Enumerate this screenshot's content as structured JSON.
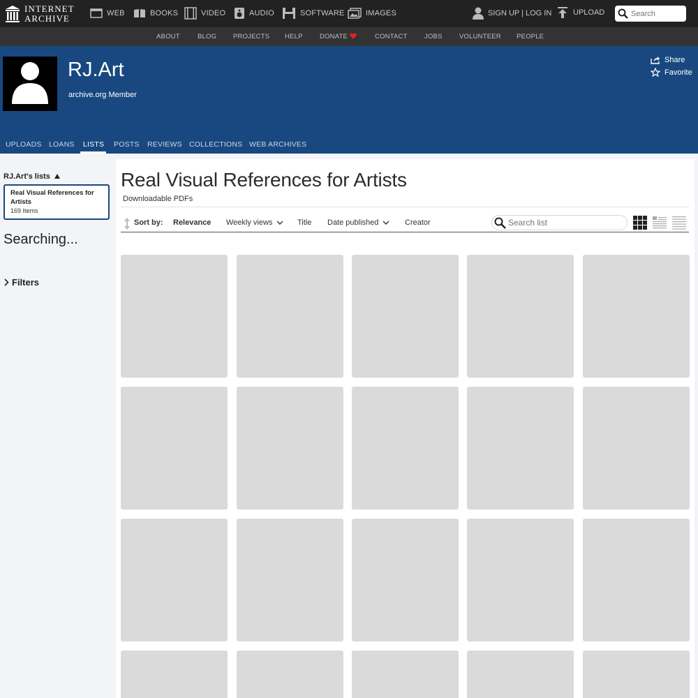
{
  "topbar": {
    "logo_line1": "INTERNET",
    "logo_line2": "ARCHIVE",
    "nav": [
      {
        "label": "WEB",
        "icon": "web-icon"
      },
      {
        "label": "BOOKS",
        "icon": "books-icon"
      },
      {
        "label": "VIDEO",
        "icon": "video-icon"
      },
      {
        "label": "AUDIO",
        "icon": "audio-icon"
      },
      {
        "label": "SOFTWARE",
        "icon": "software-icon"
      },
      {
        "label": "IMAGES",
        "icon": "images-icon"
      }
    ],
    "account_label": "SIGN UP | LOG IN",
    "upload_label": "UPLOAD",
    "search_placeholder": "Search"
  },
  "subnav": [
    "ABOUT",
    "BLOG",
    "PROJECTS",
    "HELP",
    "DONATE",
    "CONTACT",
    "JOBS",
    "VOLUNTEER",
    "PEOPLE"
  ],
  "profile": {
    "name": "RJ.Art",
    "subtitle": "archive.org Member",
    "share_label": "Share",
    "favorite_label": "Favorite",
    "tabs": [
      "UPLOADS",
      "LOANS",
      "LISTS",
      "POSTS",
      "REVIEWS",
      "COLLECTIONS",
      "WEB ARCHIVES"
    ],
    "active_tab": "LISTS"
  },
  "sidebar": {
    "lists_heading": "RJ.Art's lists",
    "list_card": {
      "title": "Real Visual References for Artists",
      "count": "169 Items"
    },
    "status": "Searching...",
    "filters_label": "Filters"
  },
  "main": {
    "title": "Real Visual References for Artists",
    "description": "Downloadable PDFs",
    "sort_label": "Sort by:",
    "sort_options": [
      "Relevance",
      "Weekly views",
      "Title",
      "Date published",
      "Creator"
    ],
    "active_sort": "Relevance",
    "search_placeholder": "Search list",
    "view_modes": [
      "grid-view-icon",
      "list-detail-view-icon",
      "list-compact-view-icon"
    ]
  },
  "colors": {
    "topbar": "#222222",
    "subnav": "#333333",
    "banner": "#194880",
    "donate_heart": "#e0202a",
    "tile_placeholder": "#dadada"
  }
}
